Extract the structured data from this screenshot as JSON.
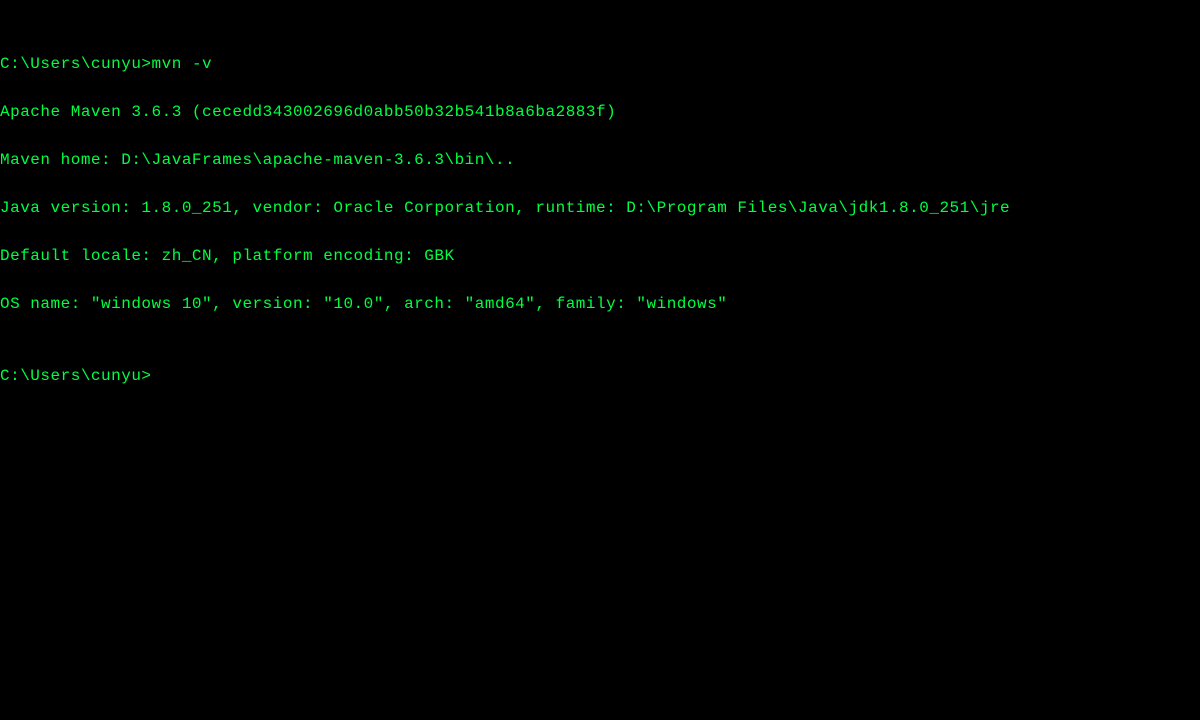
{
  "terminal": {
    "lines": [
      {
        "prompt": "C:\\Users\\cunyu>",
        "command": "mvn -v"
      },
      {
        "output": "Apache Maven 3.6.3 (cecedd343002696d0abb50b32b541b8a6ba2883f)"
      },
      {
        "output": "Maven home: D:\\JavaFrames\\apache-maven-3.6.3\\bin\\.."
      },
      {
        "output": "Java version: 1.8.0_251, vendor: Oracle Corporation, runtime: D:\\Program Files\\Java\\jdk1.8.0_251\\jre"
      },
      {
        "output": "Default locale: zh_CN, platform encoding: GBK"
      },
      {
        "output": "OS name: \"windows 10\", version: \"10.0\", arch: \"amd64\", family: \"windows\""
      },
      {
        "output": ""
      },
      {
        "prompt": "C:\\Users\\cunyu>",
        "command": ""
      }
    ]
  },
  "colors": {
    "background": "#000000",
    "foreground": "#00ff41"
  }
}
